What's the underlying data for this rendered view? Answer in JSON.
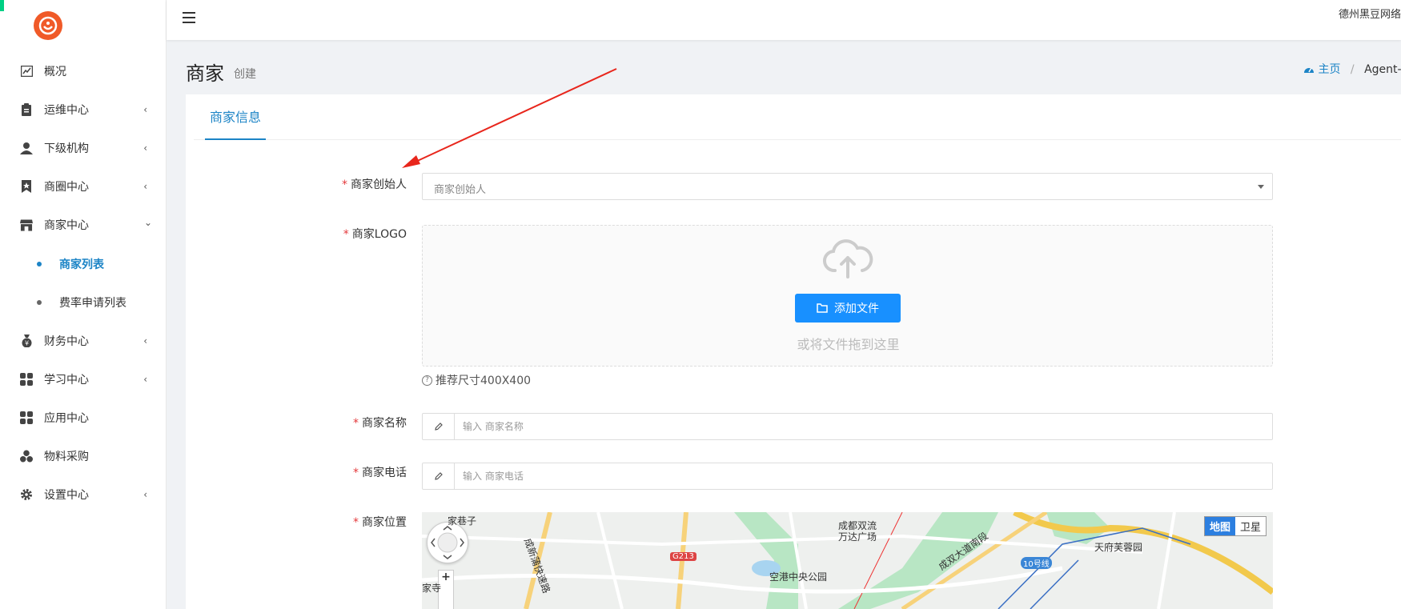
{
  "app": {
    "company": "德州黑豆网络"
  },
  "sidebar": {
    "items": [
      {
        "label": "概况",
        "icon": "chart-icon",
        "has_arrow": false
      },
      {
        "label": "运维中心",
        "icon": "clipboard-icon",
        "has_arrow": true
      },
      {
        "label": "下级机构",
        "icon": "user-icon",
        "has_arrow": true
      },
      {
        "label": "商圈中心",
        "icon": "bookmark-star-icon",
        "has_arrow": true
      },
      {
        "label": "商家中心",
        "icon": "store-icon",
        "has_arrow": true,
        "expanded": true
      },
      {
        "label": "财务中心",
        "icon": "money-bag-icon",
        "has_arrow": true
      },
      {
        "label": "学习中心",
        "icon": "grid-icon",
        "has_arrow": true
      },
      {
        "label": "应用中心",
        "icon": "grid-icon",
        "has_arrow": false
      },
      {
        "label": "物料采购",
        "icon": "cubes-icon",
        "has_arrow": false
      },
      {
        "label": "设置中心",
        "icon": "gear-icon",
        "has_arrow": true
      }
    ],
    "sub_items": [
      {
        "label": "商家列表",
        "active": true
      },
      {
        "label": "费率申请列表",
        "active": false
      }
    ],
    "arrow_left": "‹",
    "arrow_down": "⌄"
  },
  "header": {
    "menu_icon": "hamburger-icon"
  },
  "page": {
    "title": "商家",
    "subtitle": "创建",
    "breadcrumb": {
      "home": "主页",
      "separator": "/",
      "current": "Agent-U"
    }
  },
  "tabs": [
    {
      "label": "商家信息",
      "active": true
    }
  ],
  "form": {
    "required_mark": "*",
    "founder": {
      "label": "商家创始人",
      "placeholder": "商家创始人"
    },
    "logo": {
      "label": "商家LOGO",
      "button": "添加文件",
      "drop_text": "或将文件拖到这里",
      "hint": "推荐尺寸400X400"
    },
    "name": {
      "label": "商家名称",
      "placeholder": "输入 商家名称"
    },
    "phone": {
      "label": "商家电话",
      "placeholder": "输入 商家电话"
    },
    "location": {
      "label": "商家位置"
    }
  },
  "map": {
    "toggle": [
      "地图",
      "卫星"
    ],
    "zoom_in": "+",
    "labels": [
      "成都双流",
      "万达广场",
      "空港中央公园",
      "天府芙蓉园",
      "成新蒲快速路",
      "成双大道南段",
      "家巷子",
      "家寺"
    ],
    "badges": [
      "G213",
      "10号线"
    ]
  },
  "colors": {
    "accent": "#1c84c6",
    "button": "#1890ff",
    "required": "#e4393c",
    "logo": "#f05a28",
    "annotation_arrow": "#e8261c"
  }
}
